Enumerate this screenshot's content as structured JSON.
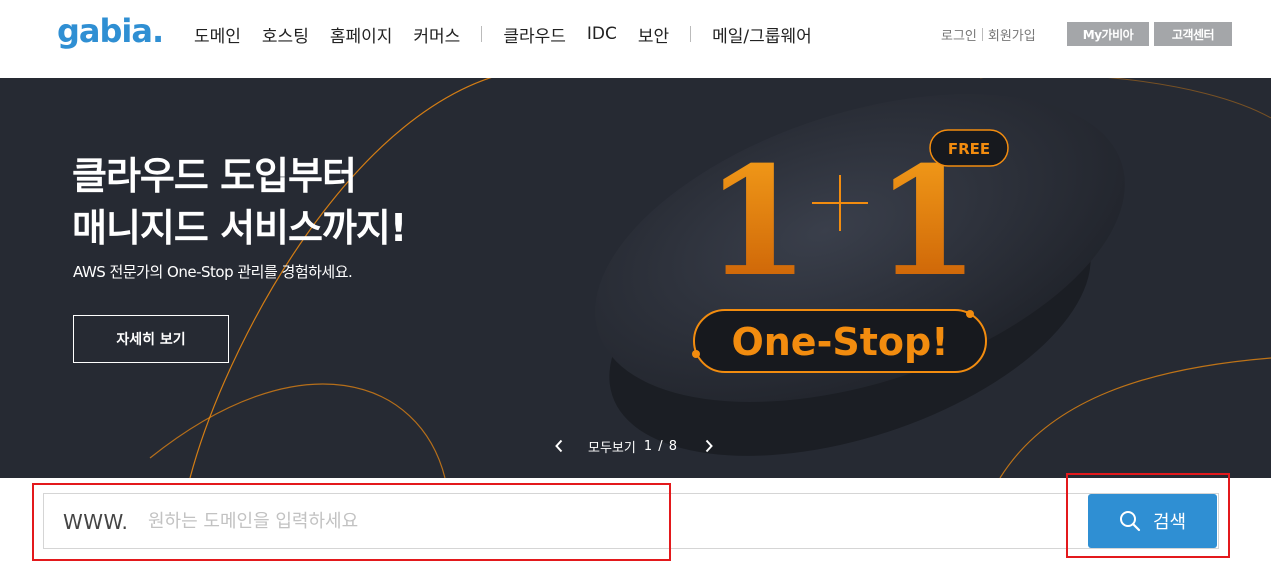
{
  "brand": {
    "logo_text": "gabia.",
    "logo_color": "#2f8fd3"
  },
  "nav": {
    "items": [
      "도메인",
      "호스팅",
      "홈페이지",
      "커머스"
    ],
    "items_group2": [
      "클라우드",
      "IDC",
      "보안"
    ],
    "items_group3": [
      "메일/그룹웨어"
    ]
  },
  "util": {
    "login": "로그인",
    "signup": "회원가입",
    "my_gabia": "My가비아",
    "customer_center": "고객센터"
  },
  "banner": {
    "headline_line1": "클라우드 도입부터",
    "headline_line2": "매니지드 서비스까지!",
    "subline": "AWS 전문가의 One-Stop 관리를 경험하세요.",
    "detail_button": "자세히 보기",
    "graphic_formula": "1+1",
    "graphic_free": "FREE",
    "graphic_badge": "One-Stop!",
    "view_all": "모두보기",
    "page_count": "1 / 8",
    "accent_color": "#f28c0f",
    "background_color": "#262a33"
  },
  "search": {
    "prefix": "WWW.",
    "placeholder": "원하는 도메인을 입력하세요",
    "value": "",
    "button_label": "검색",
    "button_color": "#2f8fd3"
  },
  "icons": [
    "chevron-left-icon",
    "chevron-right-icon",
    "search-icon"
  ]
}
